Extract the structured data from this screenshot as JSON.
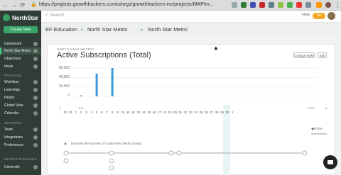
{
  "browser": {
    "url": "https://projects.growthhackers.com/u/orgs/growthhackers-inc/projects/MAP/m..."
  },
  "app": {
    "logo_text": "NorthStar",
    "new_button": "Create New",
    "search_placeholder": "Search",
    "help_label": "Help",
    "badge_count": "84"
  },
  "sidebar": {
    "items_top": [
      {
        "label": "Dashboard"
      },
      {
        "label": "North Star Metric"
      },
      {
        "label": "Objectives"
      },
      {
        "label": "Ideas"
      }
    ],
    "section_process": "PROCESS",
    "items_process": [
      {
        "label": "Workflow"
      },
      {
        "label": "Learnings"
      },
      {
        "label": "Health"
      },
      {
        "label": "Global View"
      },
      {
        "label": "Calendar"
      }
    ],
    "section_settings": "SETTINGS",
    "items_settings": [
      {
        "label": "Team"
      },
      {
        "label": "Integrations"
      },
      {
        "label": "Preferences"
      }
    ],
    "section_growthhackers": "GROWTHHACKERS",
    "items_gh": [
      {
        "label": "University"
      }
    ]
  },
  "breadcrumb": [
    "EF Education",
    "North Star Metric",
    "North Star Metric"
  ],
  "page": {
    "subtitle": "NORTH STAR METRIC",
    "title": "Active Subscriptions (Total)",
    "change_nsm": "Change NSM",
    "edit": "Edit"
  },
  "chart_data": {
    "type": "bar",
    "categories": [
      "30",
      "31",
      "1",
      "2",
      "3",
      "4",
      "5",
      "6",
      "7",
      "8",
      "9",
      "10",
      "11",
      "12",
      "13",
      "14",
      "15",
      "16",
      "17",
      "18",
      "19",
      "20",
      "21",
      "22",
      "23",
      "24",
      "25",
      "26",
      "27",
      "28",
      "29",
      "30",
      "1"
    ],
    "values": [
      0,
      0,
      0,
      2000,
      0,
      0,
      48000,
      0,
      0,
      60000,
      0,
      0,
      0,
      0,
      0,
      0,
      0,
      0,
      0,
      0,
      0,
      0,
      0,
      0,
      0,
      0,
      0,
      0,
      0,
      0,
      0,
      0,
      0
    ],
    "yticks": [
      "60,000",
      "40,000",
      "20,000",
      "0"
    ],
    "ylim": [
      0,
      60000
    ],
    "month_labels": [
      "JUL",
      "AUG"
    ],
    "color": "#3a9ad9"
  },
  "legend": {
    "label": "Version"
  },
  "timeline": {
    "label": "Increase the Number of Customers (Pedro Cesar)"
  }
}
